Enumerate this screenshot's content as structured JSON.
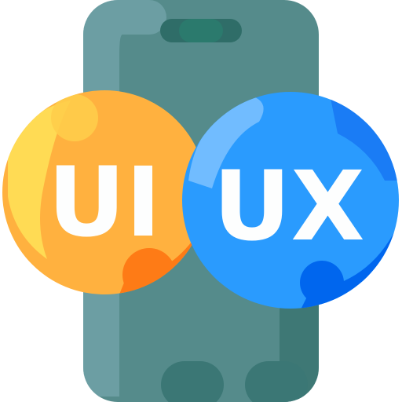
{
  "icon": {
    "name": "ui-ux-smartphone-icon",
    "left_badge": {
      "text": "UI",
      "color": "#ffb13f",
      "highlight": "#ffdd55",
      "shadow": "#fe7b16"
    },
    "right_badge": {
      "text": "UX",
      "color": "#2a9bfe",
      "highlight": "#79c0ff",
      "shadow": "#0066ee"
    },
    "phone": {
      "body_color": "#558b8b",
      "highlight_color": "#7faeb8",
      "shadow_color": "#2f6d68"
    }
  }
}
